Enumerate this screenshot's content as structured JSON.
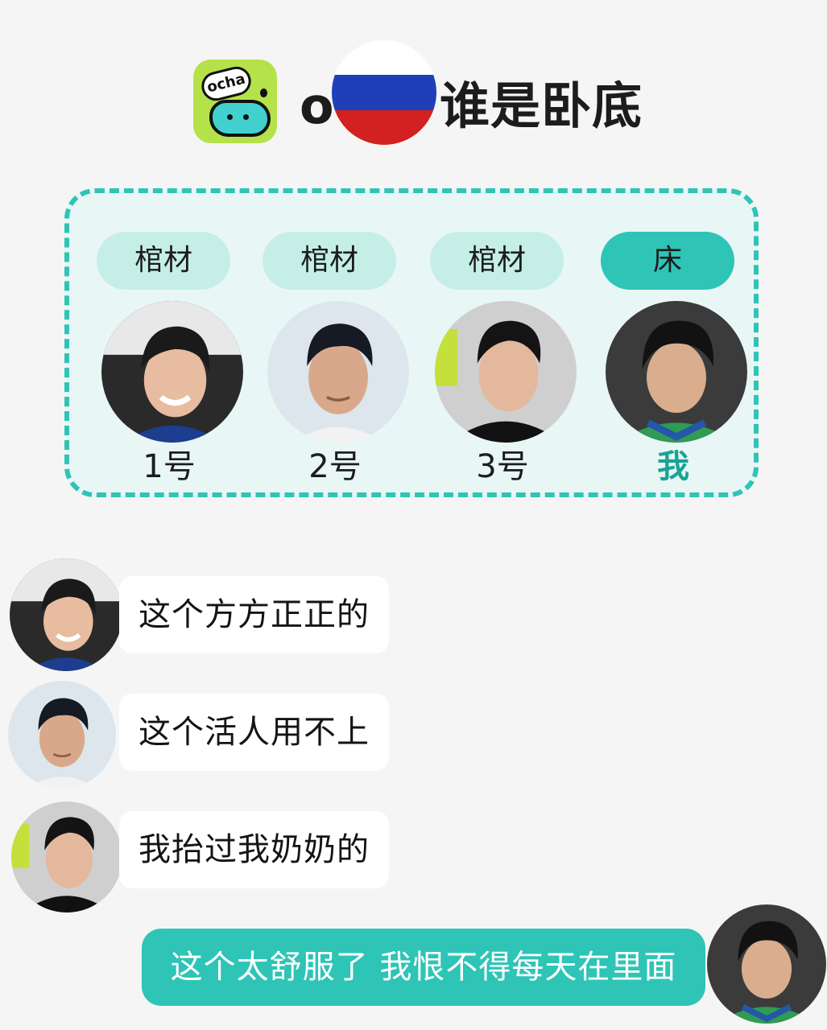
{
  "header": {
    "logo_text": "ocha",
    "title_prefix": "o",
    "title_suffix": "谁是卧底",
    "flag_colors": [
      "#ffffff",
      "#1e3fb8",
      "#d32020"
    ]
  },
  "players": [
    {
      "role": "棺材",
      "label": "1号",
      "is_me": false,
      "avatar": "portrait-1"
    },
    {
      "role": "棺材",
      "label": "2号",
      "is_me": false,
      "avatar": "portrait-2"
    },
    {
      "role": "棺材",
      "label": "3号",
      "is_me": false,
      "avatar": "portrait-3"
    },
    {
      "role": "床",
      "label": "我",
      "is_me": true,
      "avatar": "portrait-me"
    }
  ],
  "messages": [
    {
      "from": "1号",
      "text": "这个方方正正的"
    },
    {
      "from": "2号",
      "text": "这个活人用不上"
    },
    {
      "from": "3号",
      "text": "我抬过我奶奶的"
    },
    {
      "from": "我",
      "text": "这个太舒服了 我恨不得每天在里面"
    }
  ],
  "colors": {
    "accent": "#2ec4b6",
    "pill": "#c5efe6",
    "card_bg": "#e9f6f6",
    "page_bg": "#f5f5f5",
    "logo_green": "#b5e24a"
  }
}
